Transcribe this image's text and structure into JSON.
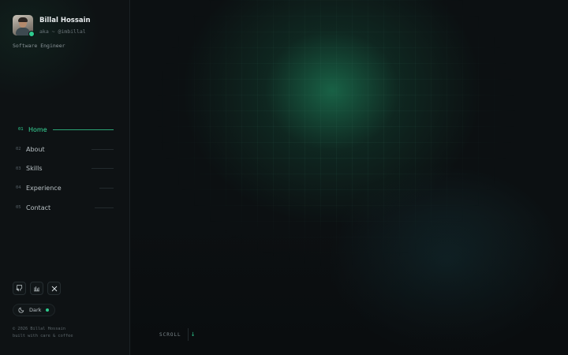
{
  "profile": {
    "name": "Billal Hossain",
    "handle": "aka ~ @imbillal",
    "role": "Software Engineer"
  },
  "nav": {
    "items": [
      {
        "num": "01",
        "label": "Home",
        "active": true
      },
      {
        "num": "02",
        "label": "About",
        "active": false
      },
      {
        "num": "03",
        "label": "Skills",
        "active": false
      },
      {
        "num": "04",
        "label": "Experience",
        "active": false
      },
      {
        "num": "05",
        "label": "Contact",
        "active": false
      }
    ]
  },
  "social": {
    "icons": [
      "github-icon",
      "bar-chart-icon",
      "x-logo-icon"
    ]
  },
  "theme": {
    "label": "Dark",
    "icon": "moon-icon"
  },
  "footer": {
    "copyright": "© 2026 Billal Hossain",
    "tagline": "built with care & coffee"
  },
  "main": {
    "scroll_label": "SCROLL",
    "scroll_arrow": "↓"
  },
  "colors": {
    "accent": "#2ecc8f",
    "background": "#0b0e10",
    "sidebar": "#0e1214"
  }
}
